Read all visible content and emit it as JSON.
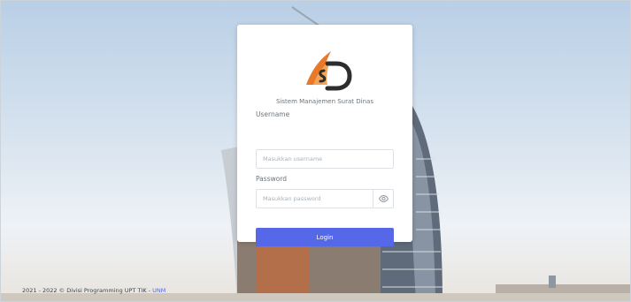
{
  "app": {
    "title": "Sistem Manajemen Surat Dinas"
  },
  "form": {
    "username_label": "Username",
    "username_placeholder": "Masukkan username",
    "password_label": "Password",
    "password_placeholder": "Masukkan password",
    "login_label": "Login"
  },
  "icons": {
    "password_toggle": "eye-icon",
    "logo": "logo-icon"
  },
  "footer": {
    "text": "2021 - 2022 © Divisi Programming UPT TIK - ",
    "link": "UNM"
  },
  "colors": {
    "accent": "#5468e8",
    "logo_orange": "#e8792a",
    "logo_dark": "#2d2d2d"
  }
}
